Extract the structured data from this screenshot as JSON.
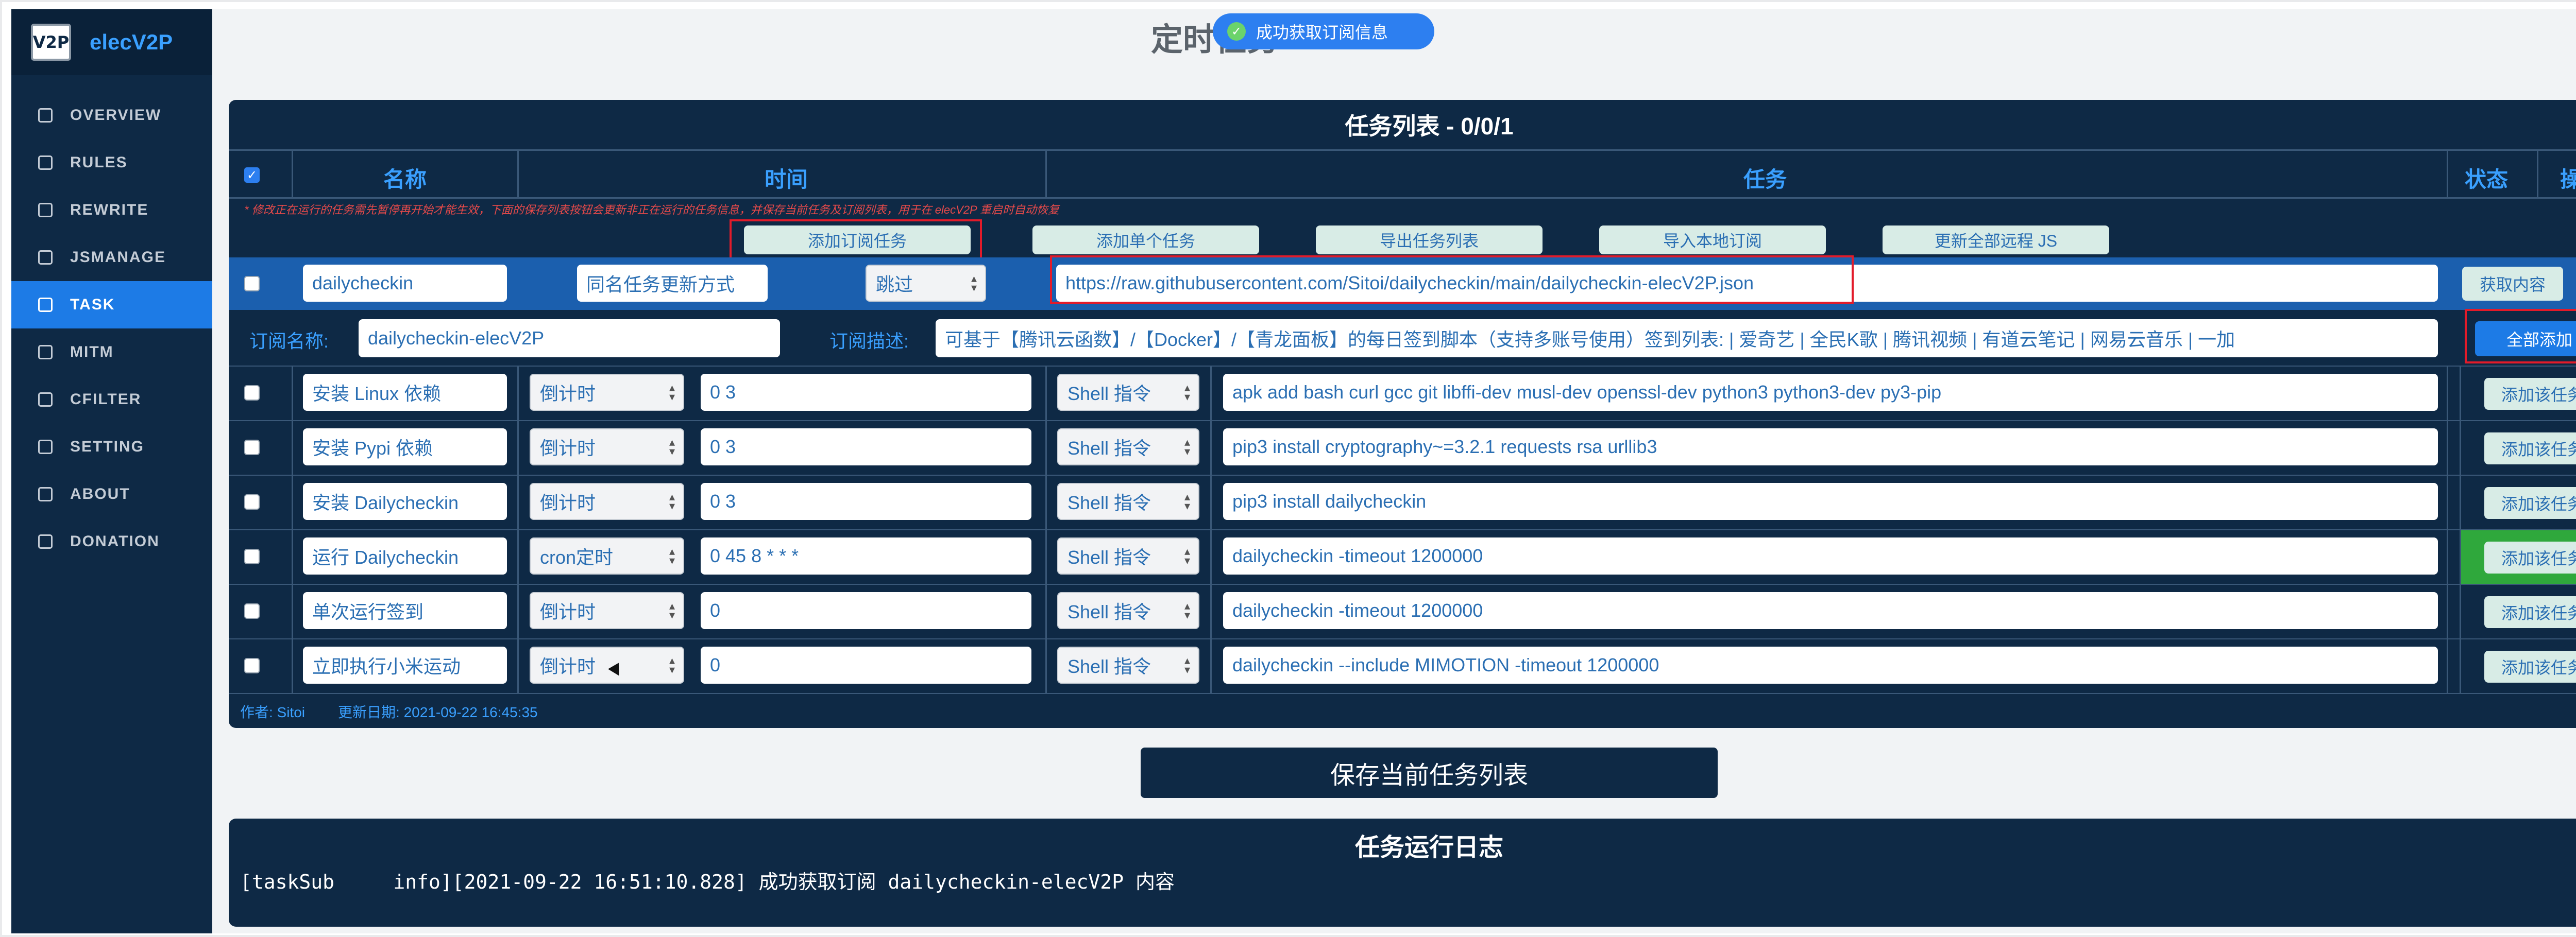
{
  "brand": {
    "logo": "V2P",
    "name": "elecV2P"
  },
  "nav": [
    {
      "label": "OVERVIEW",
      "icon": "grid-icon"
    },
    {
      "label": "RULES",
      "icon": "filter-icon"
    },
    {
      "label": "REWRITE",
      "icon": "edit-icon"
    },
    {
      "label": "JSMANAGE",
      "icon": "terminal-icon"
    },
    {
      "label": "TASK",
      "icon": "list-icon",
      "active": true
    },
    {
      "label": "MITM",
      "icon": "certificate-icon"
    },
    {
      "label": "CFILTER",
      "icon": "share-icon"
    },
    {
      "label": "SETTING",
      "icon": "gear-icon"
    },
    {
      "label": "ABOUT",
      "icon": "globe-icon"
    },
    {
      "label": "DONATION",
      "icon": "coffee-icon"
    }
  ],
  "page": {
    "title": "定时任务",
    "toast": "成功获取订阅信息"
  },
  "panel": {
    "title": "任务列表 - 0/0/1",
    "columns": {
      "name": "名称",
      "time": "时间",
      "task": "任务",
      "status": "状态",
      "action": "操作"
    },
    "warning": "* 修改正在运行的任务需先暂停再开始才能生效，下面的保存列表按钮会更新非正在运行的任务信息，并保存当前任务及订阅列表，用于在 elecV2P 重启时自动恢复",
    "buttons": [
      "添加订阅任务",
      "添加单个任务",
      "导出任务列表",
      "导入本地订阅",
      "更新全部远程 JS"
    ],
    "sub": {
      "name": "dailycheckin",
      "mode": "同名任务更新方式",
      "mode_value": "跳过",
      "url": "https://raw.githubusercontent.com/Sitoi/dailycheckin/main/dailycheckin-elecV2P.json",
      "fetch": "获取内容",
      "sub_name_label": "订阅名称:",
      "sub_name": "dailycheckin-elecV2P",
      "desc_label": "订阅描述:",
      "desc": "可基于【腾讯云函数】/【Docker】/【青龙面板】的每日签到脚本（支持多账号使用）签到列表: | 爱奇艺 | 全民K歌 | 腾讯视频 | 有道云笔记 | 网易云音乐 | 一加",
      "add_all": "全部添加"
    },
    "rows": [
      {
        "name": "安装 Linux 依赖",
        "type": "倒计时",
        "time": "0 3",
        "kind": "Shell 指令",
        "cmd": "apk add bash curl gcc git libffi-dev musl-dev openssl-dev python3 python3-dev py3-pip",
        "btn": "添加该任务"
      },
      {
        "name": "安装 Pypi 依赖",
        "type": "倒计时",
        "time": "0 3",
        "kind": "Shell 指令",
        "cmd": "pip3 install cryptography~=3.2.1 requests rsa urllib3",
        "btn": "添加该任务"
      },
      {
        "name": "安装 Dailycheckin",
        "type": "倒计时",
        "time": "0 3",
        "kind": "Shell 指令",
        "cmd": "pip3 install dailycheckin",
        "btn": "添加该任务"
      },
      {
        "name": "运行 Dailycheckin",
        "type": "cron定时",
        "time": "0 45 8 * * *",
        "kind": "Shell 指令",
        "cmd": "dailycheckin -timeout 1200000",
        "btn": "添加该任务",
        "highlight": true
      },
      {
        "name": "单次运行签到",
        "type": "倒计时",
        "time": "0",
        "kind": "Shell 指令",
        "cmd": "dailycheckin -timeout 1200000",
        "btn": "添加该任务"
      },
      {
        "name": "立即执行小米运动",
        "type": "倒计时",
        "time": "0",
        "kind": "Shell 指令",
        "cmd": "dailycheckin --include MIMOTION -timeout 1200000",
        "btn": "添加该任务"
      }
    ],
    "author": "作者: Sitoi",
    "updated": "更新日期: 2021-09-22 16:45:35"
  },
  "save_label": "保存当前任务列表",
  "log": {
    "title": "任务运行日志",
    "text": "[taskSub     info][2021-09-22 16:51:10.828] 成功获取订阅 dailycheckin-elecV2P 内容"
  }
}
